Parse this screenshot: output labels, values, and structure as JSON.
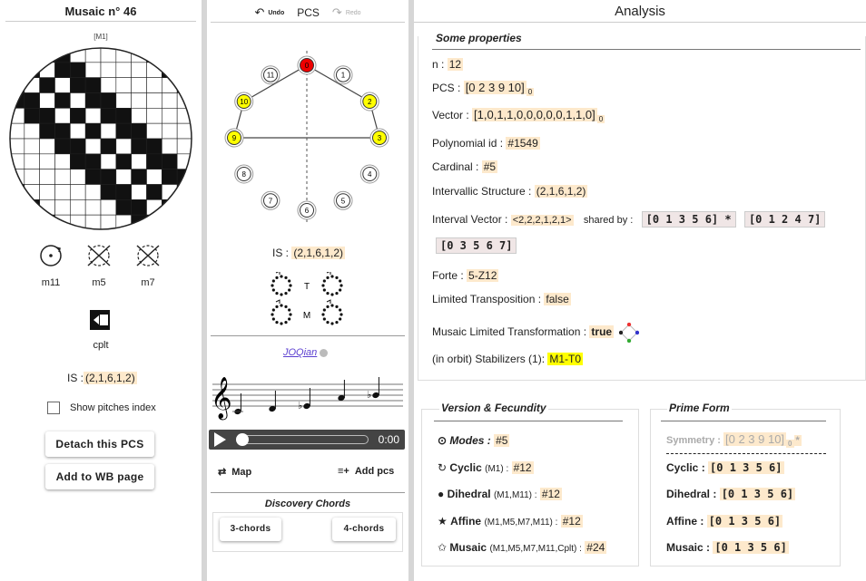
{
  "left": {
    "title": "Musaic n° 46",
    "mosaic_tag": "[M1]",
    "transforms": [
      {
        "label": "m11",
        "icon": "rotate-icon"
      },
      {
        "label": "m5",
        "icon": "cross-arrows-icon"
      },
      {
        "label": "m7",
        "icon": "cross-arrows-icon"
      }
    ],
    "cplt_label": "cplt",
    "is_label": "IS :",
    "is_value": "(2,1,6,1,2)",
    "show_pitches": "Show pitches index",
    "detach_btn": "Detach this PCS",
    "add_wb_btn": "Add to WB page"
  },
  "middle": {
    "undo": "Undo",
    "pcs": "PCS",
    "redo": "Redo",
    "clock_nums": [
      "0",
      "1",
      "2",
      "3",
      "4",
      "5",
      "6",
      "7",
      "8",
      "9",
      "10",
      "11"
    ],
    "active": [
      0,
      2,
      3,
      9,
      10
    ],
    "is_label": "IS :",
    "is_value": "(2,1,6,1,2)",
    "t_label": "T",
    "m_label": "M",
    "composer_link": "JOQian",
    "time": "0:00",
    "map_btn": "Map",
    "add_pcs_btn": "Add pcs",
    "discovery_title": "Discovery Chords",
    "chords3": "3-chords",
    "chords4": "4-chords"
  },
  "right": {
    "header": "Analysis",
    "props_title": "Some properties",
    "n_label": "n :",
    "n_val": "12",
    "pcs_label": "PCS :",
    "pcs_val": "[0 2 3 9 10]",
    "pcs_sub": "0",
    "vector_label": "Vector :",
    "vector_val": "[1,0,1,1,0,0,0,0,0,1,1,0]",
    "vector_sub": "0",
    "poly_label": "Polynomial id :",
    "poly_val": "#1549",
    "card_label": "Cardinal :",
    "card_val": "#5",
    "is_label": "Intervallic Structure :",
    "is_val": "(2,1,6,1,2)",
    "iv_label": "Interval Vector :",
    "iv_val": "<2,2,2,1,2,1>",
    "shared_label": "shared by :",
    "shared": [
      "[0 1 3 5 6] *",
      "[0 1 2 4 7]",
      "[0 3 5 6 7]"
    ],
    "forte_label": "Forte :",
    "forte_val": "5-Z12",
    "lt_label": "Limited Transposition :",
    "lt_val": "false",
    "mlt_label": "Musaic Limited Transformation :",
    "mlt_val": "true",
    "stab_label": "(in orbit) Stabilizers (1):",
    "stab_val": "M1-T0",
    "vf_title": "Version & Fecundity",
    "modes_label": "Modes :",
    "modes_val": "#5",
    "cyclic_label": "Cyclic",
    "cyclic_grp": "(M1) :",
    "cyclic_val": "#12",
    "dihedral_label": "Dihedral",
    "dihedral_grp": "(M1,M11) :",
    "dihedral_val": "#12",
    "affine_label": "Affine",
    "affine_grp": "(M1,M5,M7,M11) :",
    "affine_val": "#12",
    "musaic_label": "Musaic",
    "musaic_grp": "(M1,M5,M7,M11,Cplt) :",
    "musaic_val": "#24",
    "pf_title": "Prime Form",
    "sym_label": "Symmetry :",
    "sym_val": "[0 2 3 9 10]",
    "sym_sub": "0",
    "sym_star": "*",
    "pf_cyclic": "Cyclic :",
    "pf_cyclic_val": "[0 1 3 5 6]",
    "pf_dihedral": "Dihedral :",
    "pf_dihedral_val": "[0 1 3 5 6]",
    "pf_affine": "Affine :",
    "pf_affine_val": "[0 1 3 5 6]",
    "pf_musaic": "Musaic :",
    "pf_musaic_val": "[0 1 3 5 6]"
  }
}
